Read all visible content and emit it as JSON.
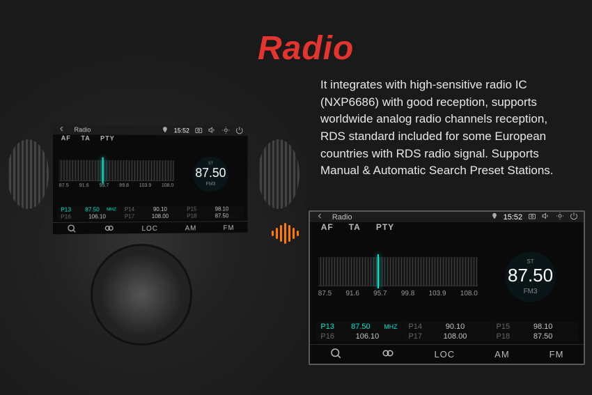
{
  "title": "Radio",
  "description": "It integrates with high-sensitive radio IC (NXP6686) with good reception, supports worldwide analog radio channels reception, RDS standard included for some European countries with RDS radio signal. Supports Manual & Automatic Search Preset Stations.",
  "radio": {
    "app_label": "Radio",
    "time": "15:52",
    "modes": {
      "af": "AF",
      "ta": "TA",
      "pty": "PTY"
    },
    "scale": [
      "87.5",
      "91.6",
      "95.7",
      "99.8",
      "103.9",
      "108.0"
    ],
    "dial": {
      "st": "ST",
      "freq": "87.50",
      "band": "FM3"
    },
    "presets": [
      {
        "num": "P13",
        "freq": "87.50",
        "unit": "MHZ",
        "active": true
      },
      {
        "num": "P14",
        "freq": "90.10",
        "unit": "",
        "active": false
      },
      {
        "num": "P15",
        "freq": "98.10",
        "unit": "",
        "active": false
      },
      {
        "num": "P16",
        "freq": "106.10",
        "unit": "",
        "active": false
      },
      {
        "num": "P17",
        "freq": "108.00",
        "unit": "",
        "active": false
      },
      {
        "num": "P18",
        "freq": "87.50",
        "unit": "",
        "active": false
      }
    ],
    "bottom": {
      "loc": "LOC",
      "am": "AM",
      "fm": "FM"
    }
  }
}
